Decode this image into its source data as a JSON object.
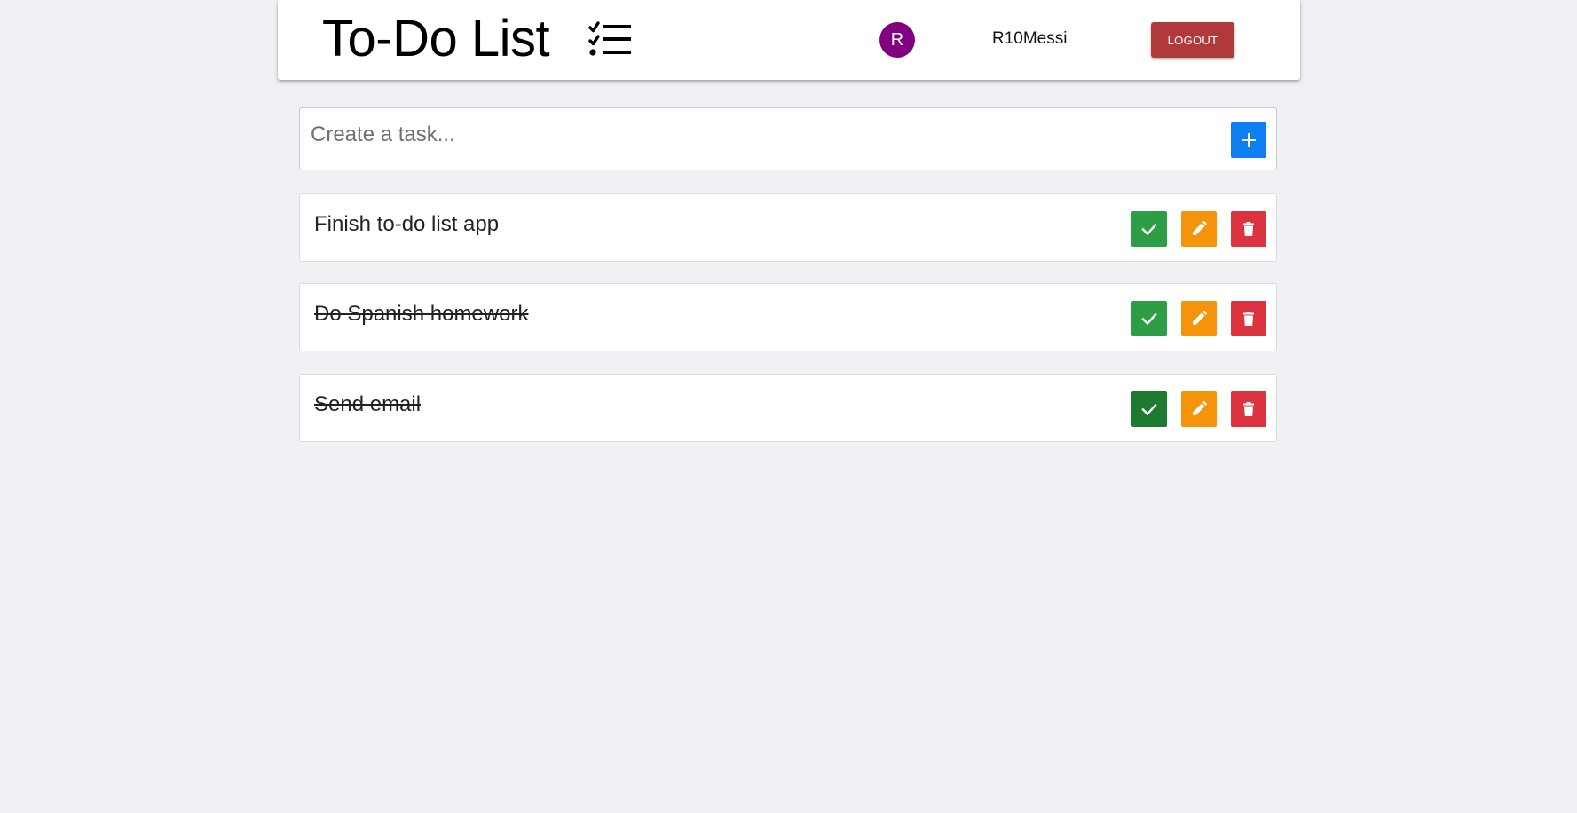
{
  "header": {
    "title": "To-Do List",
    "title_icon": "checklist-icon",
    "avatar_initial": "R",
    "avatar_color": "#800080",
    "username": "R10Messi",
    "logout_label": "LOGOUT"
  },
  "create": {
    "placeholder": "Create a task...",
    "value": "",
    "add_icon": "plus-icon"
  },
  "tasks": [
    {
      "text": "Finish to-do list app",
      "completed": false
    },
    {
      "text": "Do Spanish homework",
      "completed": true
    },
    {
      "text": "Send email",
      "completed": true
    }
  ],
  "actions": {
    "complete_icon": "check-icon",
    "edit_icon": "pencil-icon",
    "delete_icon": "trash-icon"
  },
  "colors": {
    "background": "#f0f1f5",
    "add": "#0d7ff0",
    "complete": "#2e9e46",
    "edit": "#f5940a",
    "delete": "#db3440",
    "logout": "#b03a3a"
  }
}
